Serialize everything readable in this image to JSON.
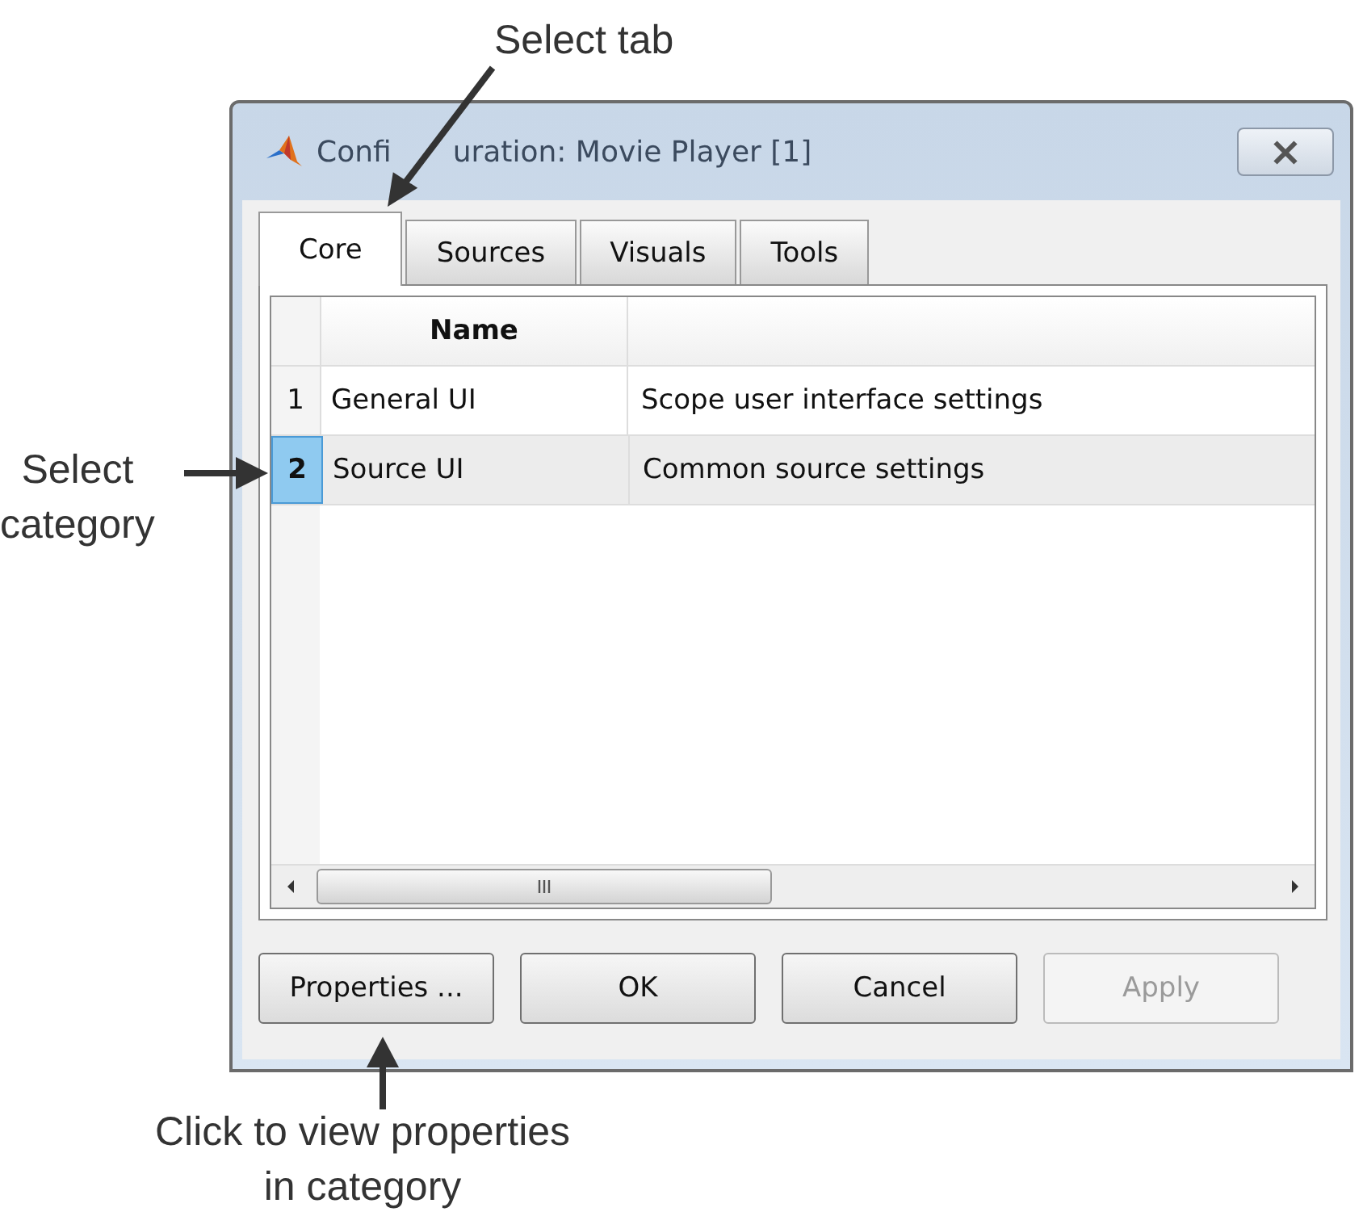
{
  "callouts": [
    {
      "kind": "top",
      "lines": [
        "Select tab"
      ]
    },
    {
      "kind": "left",
      "lines": [
        "Select",
        "category"
      ]
    },
    {
      "kind": "bottom",
      "lines": [
        "Click to view properties",
        "in category"
      ]
    }
  ],
  "window": {
    "title": [
      "Confi",
      "uration: Movie Player [1]"
    ]
  },
  "tabs": [
    {
      "label": "Core",
      "selected": true
    },
    {
      "label": "Sources",
      "selected": false
    },
    {
      "label": "Visuals",
      "selected": false
    },
    {
      "label": "Tools",
      "selected": false
    }
  ],
  "table": {
    "columns": [
      "Name"
    ],
    "rows": [
      {
        "number": "1",
        "name": "General UI",
        "column_2": "Scope user interface settings",
        "selected": false
      },
      {
        "number": "2",
        "name": "Source UI",
        "column_2": "Common source settings",
        "selected": true
      }
    ]
  },
  "buttons": [
    {
      "label": "Properties ...",
      "disabled": false
    },
    {
      "label": "OK",
      "disabled": false
    },
    {
      "label": "Cancel",
      "disabled": false
    },
    {
      "label": "Apply",
      "disabled": true
    }
  ]
}
